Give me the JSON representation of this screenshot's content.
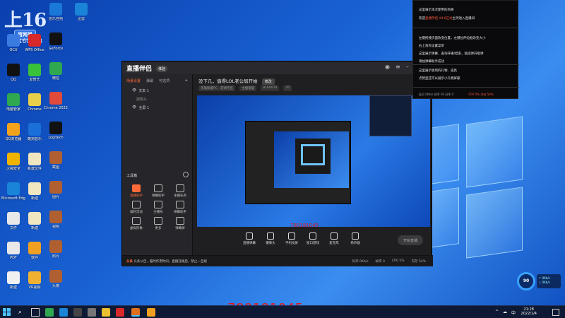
{
  "desktop": {
    "brand": {
      "big": "上16",
      "sub": "官网号",
      "id": "0160078"
    },
    "icons_col1": [
      {
        "label": "OCU",
        "color": "#3a7be0"
      },
      {
        "label": "QQ",
        "color": "#111"
      },
      {
        "label": "电脑管家",
        "color": "#2fa84f"
      },
      {
        "label": "QQ浏览器",
        "color": "#f3a21c"
      },
      {
        "label": "火绒安全",
        "color": "#f0b400"
      },
      {
        "label": "Microsoft Edge",
        "color": "#1a84d8"
      },
      {
        "label": "文件",
        "color": "#e8e8e8"
      },
      {
        "label": "PDF",
        "color": "#e8e8e8"
      },
      {
        "label": "新建",
        "color": "#f0f0f0"
      }
    ],
    "icons_col2": [
      {
        "label": "WPS Office",
        "color": "#d8282a"
      },
      {
        "label": "爱奇艺",
        "color": "#3ac13a"
      },
      {
        "label": "Chrome",
        "color": "#e8d04a"
      },
      {
        "label": "酷狗音乐",
        "color": "#1a6fd8"
      },
      {
        "label": "新建文件",
        "color": "#f0e6c0"
      },
      {
        "label": "新建",
        "color": "#f0e6c0"
      },
      {
        "label": "新建",
        "color": "#f0e6c0"
      },
      {
        "label": "软件",
        "color": "#f0a020"
      },
      {
        "label": "VR视频",
        "color": "#f0b030"
      }
    ],
    "icons_col3": [
      {
        "label": "伯乐自拍",
        "color": "#1a78d8"
      },
      {
        "label": "GeForce",
        "color": "#111"
      },
      {
        "label": "微信",
        "color": "#2fa84f"
      },
      {
        "label": "Chrome 2022",
        "color": "#e04a3a"
      },
      {
        "label": "Logitech",
        "color": "#111"
      },
      {
        "label": "截图",
        "color": "#b06030"
      },
      {
        "label": "图片",
        "color": "#b06030"
      },
      {
        "label": "视频",
        "color": "#b06030"
      },
      {
        "label": "照片",
        "color": "#b06030"
      },
      {
        "label": "头像",
        "color": "#b06030"
      }
    ],
    "icons_col4": [
      {
        "label": "迅雷",
        "color": "#1a84d8"
      }
    ]
  },
  "app": {
    "title": "直播伴侣",
    "title_tag": "体验",
    "side_tabs": [
      "场景设置",
      "弹幕",
      "可选项"
    ],
    "scenes": [
      {
        "label": "文本 1",
        "sub": false
      },
      {
        "label": "摄像头",
        "sub": true
      },
      {
        "label": "全屏 1",
        "sub": false
      }
    ],
    "tool_head": "工具箱",
    "tools": [
      {
        "label": "直播助手",
        "hot": true
      },
      {
        "label": "弹幕助手",
        "hot": false
      },
      {
        "label": "主播任务",
        "hot": false
      },
      {
        "label": "福利活动",
        "hot": false
      },
      {
        "label": "主播号",
        "hot": false
      },
      {
        "label": "弹幕助手",
        "hot": false
      },
      {
        "label": "虚拟形象",
        "hot": false
      },
      {
        "label": "更多",
        "hot": false
      },
      {
        "label": "弹幕屏",
        "hot": false
      }
    ],
    "stream_title": "没下几，值得LOL老公局开始",
    "stream_edit": "修改",
    "stream_meta": [
      "英雄联盟PC · 游戏专区",
      "主播电脑",
      "9160078",
      "76"
    ],
    "controls": [
      "直播弹幕",
      "摄像头",
      "手机投屏",
      "窗口游戏",
      "麦克风",
      "扬声器"
    ],
    "start_label": "开始直播",
    "status_tip_prefix": "头条",
    "status_tip": "头条公告，临时作用时间，直播违规后，禁止一旦规",
    "stats": [
      "码率 0Kb/s",
      "帧率 0",
      "CPU 5%",
      "内存 54%"
    ],
    "overlay_id": "780181045"
  },
  "notice": {
    "lines": [
      {
        "pre": "这里展示本次使用的风格",
        "em": "",
        "post": ""
      },
      {
        "pre": "欢迎",
        "em": "直播伴侣 V4.0正式",
        "post": "主持进入直播间"
      },
      {
        "pre": "左键拖拽页面改变位置，左键拉伸边框改变大小",
        "em": "",
        "post": ""
      },
      {
        "pre": "右上角有设置菜单",
        "em": "",
        "post": ""
      },
      {
        "pre": "这里展示弹幕、查询开播/结束，粘连弹开版弹",
        "em": "",
        "post": ""
      },
      {
        "pre": "请加弹幕助手成功",
        "em": "",
        "post": ""
      },
      {
        "pre": "这里展示收到的礼物、道具",
        "em": "",
        "post": ""
      },
      {
        "pre": "点赞里还可以展示小礼物屏蔽",
        "em": "",
        "post": ""
      }
    ],
    "foot_left": "延迟 0Kb/s  帧率 00  码率 0",
    "foot_right": "CPU 5%  内存 54%"
  },
  "widgets": {
    "gauge": "90",
    "net_up": "↑ 0Kb/s",
    "net_down": "↓ 0Kb/s"
  },
  "watermark": "780181045",
  "taskbar": {
    "time": "21:28",
    "date": "2022/1/4",
    "tray": [
      "^",
      "☁",
      "中"
    ]
  }
}
